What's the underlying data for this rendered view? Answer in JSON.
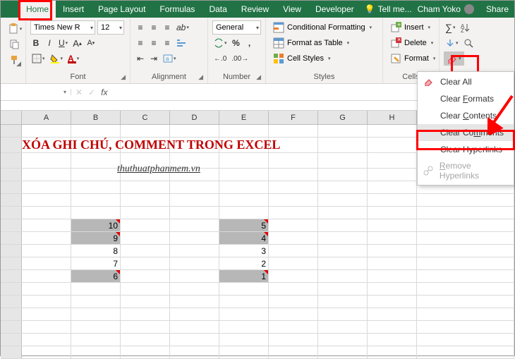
{
  "tabs": [
    "Home",
    "Insert",
    "Page Layout",
    "Formulas",
    "Data",
    "Review",
    "View",
    "Developer"
  ],
  "tellme": "Tell me...",
  "user": "Cham Yoko",
  "share": "Share",
  "font": {
    "name": "Times New R",
    "size": "12"
  },
  "numfmt": "General",
  "styles": {
    "cf": "Conditional Formatting",
    "ft": "Format as Table",
    "cs": "Cell Styles"
  },
  "cells": {
    "insert": "Insert",
    "delete": "Delete",
    "format": "Format"
  },
  "group_labels": {
    "font": "Font",
    "alignment": "Alignment",
    "number": "Number",
    "styles": "Styles",
    "cells": "Cells"
  },
  "clear_menu": {
    "all": "Clear All",
    "formats": "Clear Formats",
    "contents": "Clear Contents",
    "comments": "Clear Comments",
    "hyper": "Clear Hyperlinks",
    "remove": "Remove Hyperlinks"
  },
  "formula_bar": {
    "fx": "fx"
  },
  "columns": [
    "A",
    "B",
    "C",
    "D",
    "E",
    "F",
    "G",
    "H"
  ],
  "title_text": "XÓA GHI CHÚ, COMMENT TRONG EXCEL",
  "subtitle_text": "thuthuatphanmem.vn",
  "data_cells": {
    "B8": "10",
    "B9": "9",
    "B10": "8",
    "B11": "7",
    "B12": "6",
    "E8": "5",
    "E9": "4",
    "E10": "3",
    "E11": "2",
    "E12": "1"
  },
  "chart_data": {
    "type": "table",
    "columns": [
      "B",
      "E"
    ],
    "rows": [
      {
        "B": 10,
        "E": 5
      },
      {
        "B": 9,
        "E": 4
      },
      {
        "B": 8,
        "E": 3
      },
      {
        "B": 7,
        "E": 2
      },
      {
        "B": 6,
        "E": 1
      }
    ]
  }
}
